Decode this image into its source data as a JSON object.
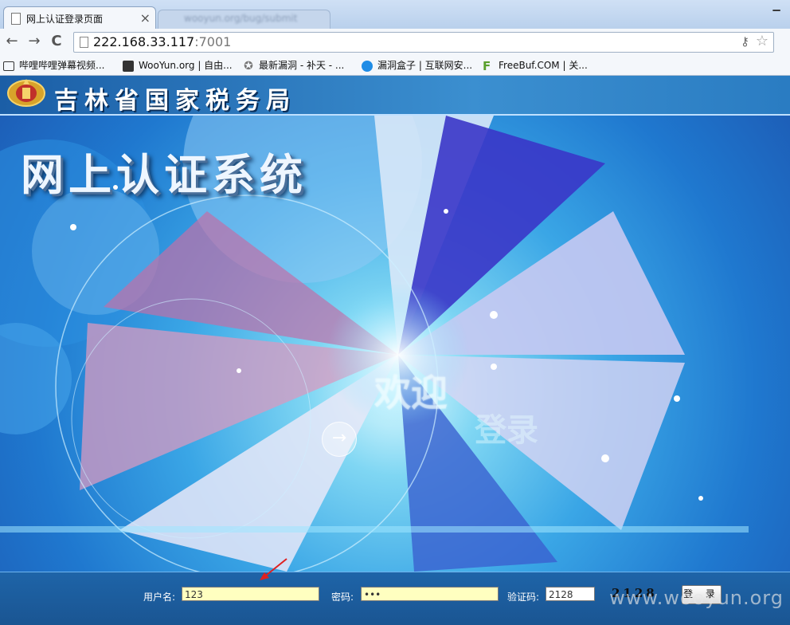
{
  "browser": {
    "tab_title": "网上认证登录页面",
    "tab_close": "×",
    "inactive_tab_text": "wooyun.org/bug/submit",
    "url_host": "222.168.33.117",
    "url_port": ":7001",
    "nav": {
      "back": "←",
      "forward": "→",
      "reload": "C"
    },
    "bookmarks": [
      {
        "label": "哔哩哔哩弹幕视频...",
        "icon": "bilibili-icon",
        "color": "#333333"
      },
      {
        "label": "WooYun.org | 自由...",
        "icon": "wooyun-icon",
        "color": "#333333"
      },
      {
        "label": "最新漏洞 - 补天 - ...",
        "icon": "butian-icon",
        "color": "#777777"
      },
      {
        "label": "漏洞盒子 | 互联网安...",
        "icon": "vulbox-icon",
        "color": "#1f8ce6"
      },
      {
        "label": "FreeBuf.COM | 关...",
        "icon": "freebuf-icon",
        "color": "#5aa02c"
      }
    ]
  },
  "page": {
    "header_title": "吉林省国家税务局",
    "system_title": "网上认证系统",
    "welcome_line1": "欢迎",
    "welcome_line2": "登录",
    "arrow": "→",
    "login": {
      "username_label": "用户名:",
      "username_value": "123",
      "password_label": "密码:",
      "password_value": "•••",
      "captcha_label": "验证码:",
      "captcha_value": "2128",
      "captcha_image_text": "2128",
      "login_button": "登 录"
    },
    "watermark": "www.wooyun.org"
  },
  "colors": {
    "header_blue": "#1b5ea6",
    "input_yellow": "#ffffc0",
    "annotation_red": "#e02020"
  }
}
